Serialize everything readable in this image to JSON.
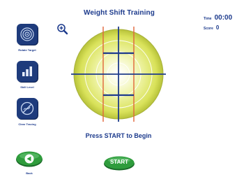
{
  "window": {
    "title": "Weight Shift Training"
  },
  "hud": {
    "time_label": "Time",
    "time_value": "00:00",
    "score_label": "Score",
    "score_value": "0"
  },
  "tools": [
    {
      "label": "Rotate Target",
      "icon": "target-icon"
    },
    {
      "label": "Skill Level",
      "icon": "bar-chart-icon"
    },
    {
      "label": "Clear Tracing",
      "icon": "clear-tracing-icon"
    }
  ],
  "zoom": {
    "icon": "zoom-in-icon"
  },
  "prompt": "Press START to Begin",
  "buttons": {
    "start_label": "START",
    "back_label": "Back"
  },
  "colors": {
    "brand_blue": "#1c3a8c",
    "target_yellow": "#d9e25a",
    "button_green": "#2f9c3c",
    "guide_red": "#e0653a"
  }
}
